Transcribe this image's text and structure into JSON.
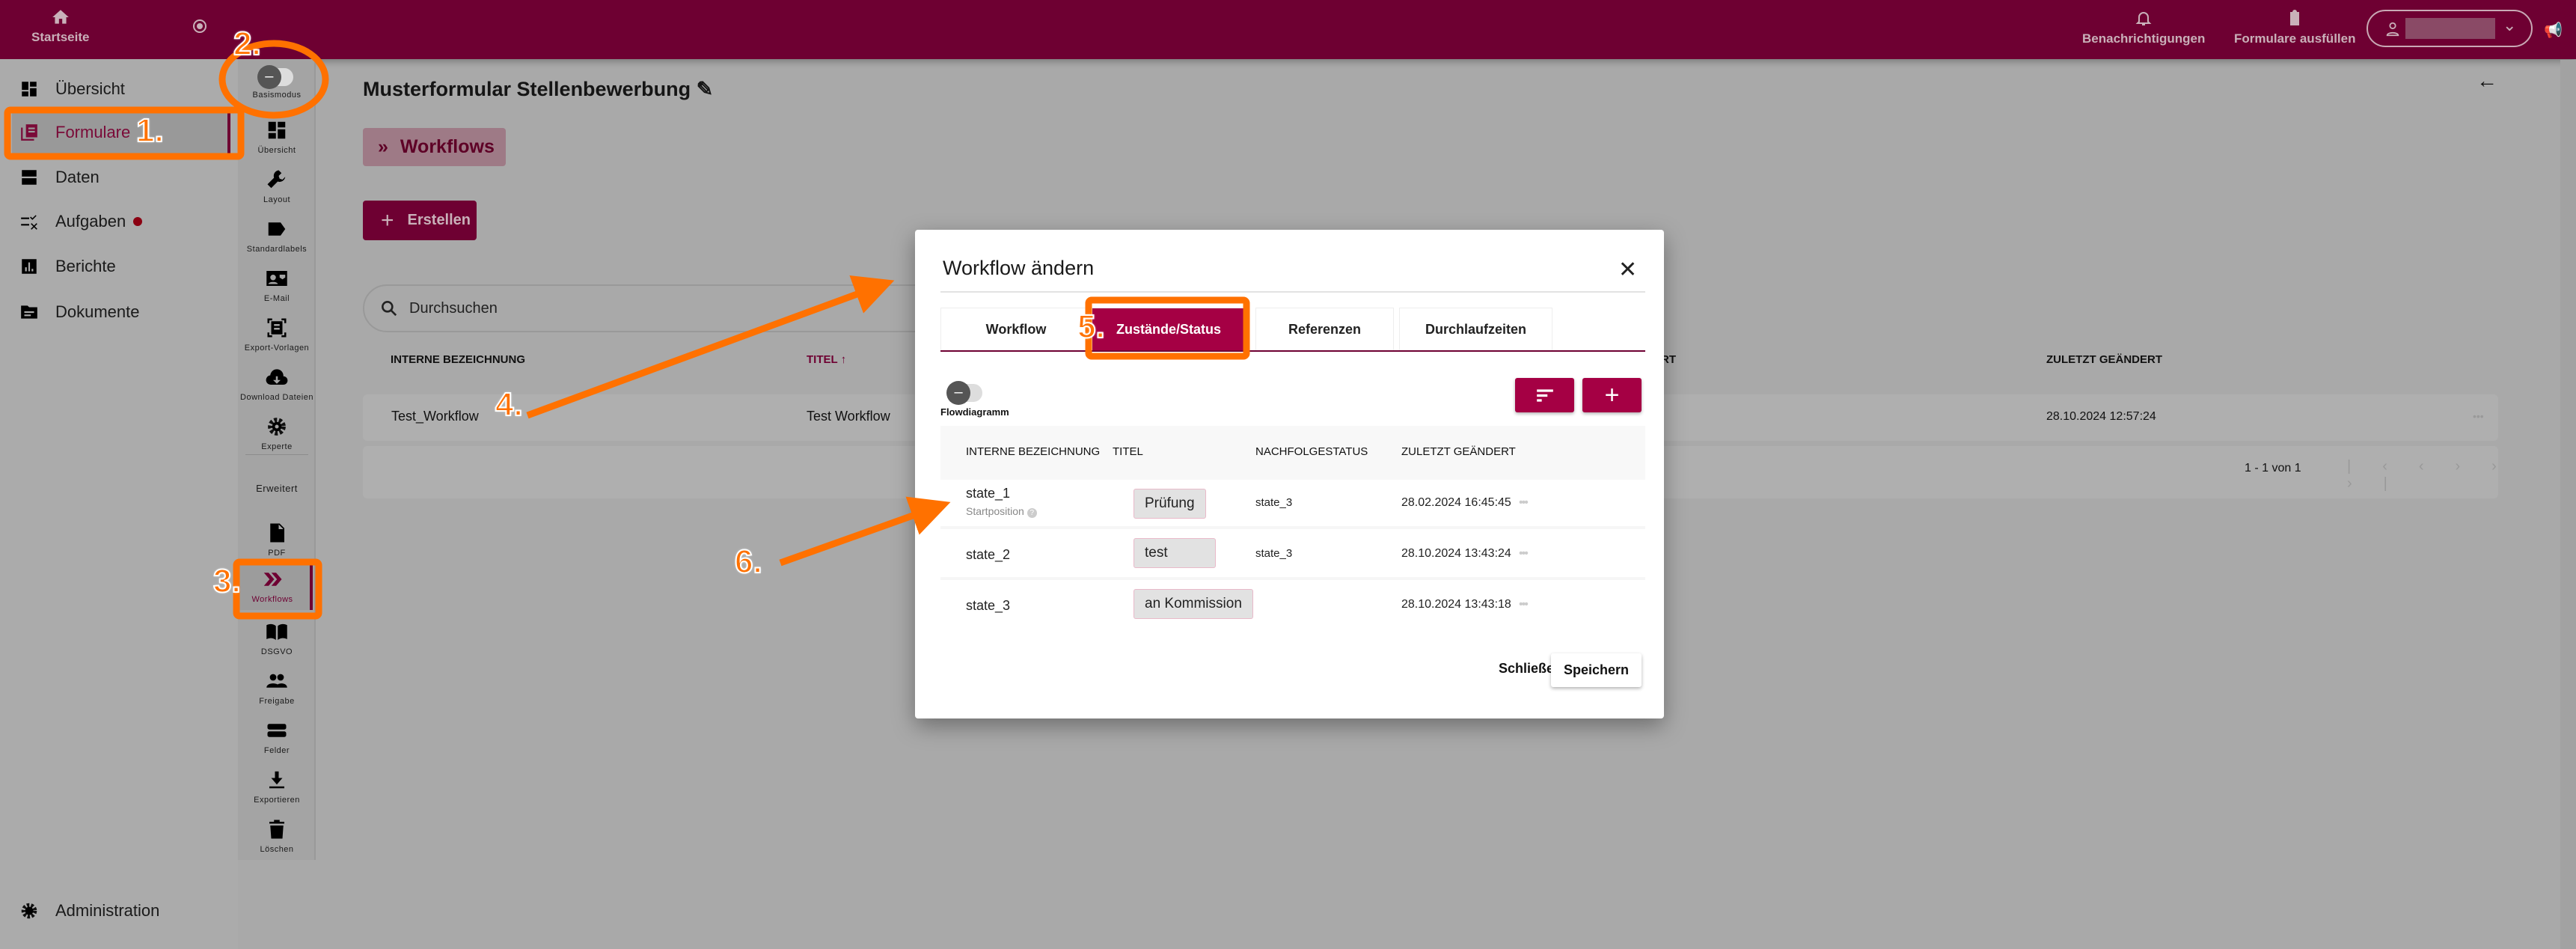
{
  "topbar": {
    "home_label": "Startseite",
    "notifications_label": "Benachrichtigungen",
    "fill_forms_label": "Formulare ausfüllen",
    "accent": "#6e0032"
  },
  "sidebar": {
    "items": [
      {
        "label": "Übersicht"
      },
      {
        "label": "Formulare"
      },
      {
        "label": "Daten"
      },
      {
        "label": "Aufgaben"
      },
      {
        "label": "Berichte"
      },
      {
        "label": "Dokumente"
      }
    ],
    "admin_label": "Administration"
  },
  "rail": {
    "toggle_label": "Basismodus",
    "items": [
      {
        "label": "Übersicht"
      },
      {
        "label": "Layout"
      },
      {
        "label": "Standardlabels"
      },
      {
        "label": "E-Mail"
      },
      {
        "label": "Export-Vorlagen"
      },
      {
        "label": "Download Dateien"
      },
      {
        "label": "Experte"
      }
    ],
    "section_label": "Erweitert",
    "advanced": [
      {
        "label": "PDF"
      },
      {
        "label": "Workflows"
      },
      {
        "label": "DSGVO"
      },
      {
        "label": "Freigabe"
      },
      {
        "label": "Felder"
      },
      {
        "label": "Exportieren"
      },
      {
        "label": "Löschen"
      }
    ]
  },
  "main": {
    "title": "Musterformular Stellenbewerbung",
    "section_chip": "Workflows",
    "create_label": "Erstellen",
    "search_placeholder": "Durchsuchen",
    "columns": [
      "INTERNE BEZEICHNUNG",
      "TITEL",
      "ERT",
      "ZULETZT GEÄNDERT"
    ],
    "rows": [
      {
        "internal": "Test_Workflow",
        "title": "Test Workflow",
        "changed": "28.10.2024 12:57:24"
      }
    ],
    "pagination": "1 - 1 von 1"
  },
  "modal": {
    "title": "Workflow ändern",
    "tabs": [
      {
        "label": "Workflow"
      },
      {
        "label": "Zustände/Status"
      },
      {
        "label": "Referenzen"
      },
      {
        "label": "Durchlaufzeiten"
      }
    ],
    "active_tab": "Zustände/Status",
    "toggle_label": "Flowdiagramm",
    "columns": [
      "INTERNE BEZEICHNUNG",
      "TITEL",
      "NACHFOLGESTATUS",
      "ZULETZT GEÄNDERT"
    ],
    "rows": [
      {
        "internal": "state_1",
        "sub": "Startposition",
        "title": "Prüfung",
        "next": "state_3",
        "changed": "28.02.2024 16:45:45"
      },
      {
        "internal": "state_2",
        "title": "test",
        "next": "state_3",
        "changed": "28.10.2024 13:43:24"
      },
      {
        "internal": "state_3",
        "title": "an Kommission",
        "next": "",
        "changed": "28.10.2024 13:43:18"
      }
    ],
    "close_label": "Schließen",
    "save_label": "Speichern",
    "accent": "#a50044"
  },
  "annotations": [
    "1.",
    "2.",
    "3.",
    "4.",
    "5.",
    "6."
  ]
}
